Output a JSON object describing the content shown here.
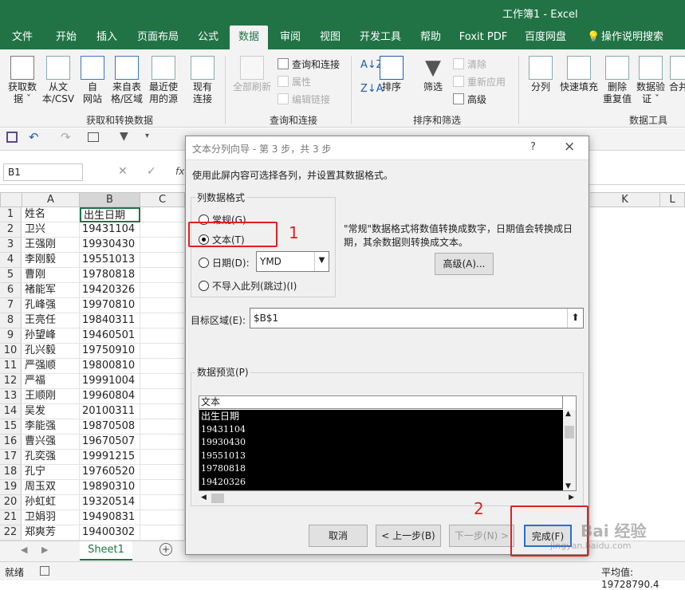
{
  "window": {
    "title": "工作簿1  -  Excel"
  },
  "tabs": [
    "文件",
    "开始",
    "插入",
    "页面布局",
    "公式",
    "数据",
    "审阅",
    "视图",
    "开发工具",
    "帮助",
    "Foxit PDF",
    "百度网盘",
    "操作说明搜索"
  ],
  "active_tab": "数据",
  "ribbon": {
    "get_data": [
      "获取数",
      "据 ˇ"
    ],
    "from_text": [
      "从文",
      "本/CSV"
    ],
    "from_web": [
      "自",
      "网站"
    ],
    "from_table": [
      "来自表",
      "格/区域"
    ],
    "recent_sources": [
      "最近使",
      "用的源"
    ],
    "existing_conn": [
      "现有",
      "连接"
    ],
    "group_get": "获取和转换数据",
    "refresh_all": [
      "全部刷新"
    ],
    "queries_conn": "查询和连接",
    "properties": "属性",
    "edit_links": "编辑链接",
    "group_queries": "查询和连接",
    "sort": "排序",
    "filter": "筛选",
    "clear": "清除",
    "reapply": "重新应用",
    "advanced": "高级",
    "group_sort": "排序和筛选",
    "split": "分列",
    "flash_fill": "快速填充",
    "remove_dup": [
      "删除",
      "重复值"
    ],
    "validation": [
      "数据验",
      "证 ˇ"
    ],
    "merge": [
      "合并"
    ],
    "group_tools": "数据工具"
  },
  "namebox": "B1",
  "fx": "fx",
  "columns": [
    "A",
    "B",
    "C",
    "K",
    "L"
  ],
  "rows": [
    [
      "1",
      "姓名",
      "出生日期"
    ],
    [
      "2",
      "卫兴",
      "19431104"
    ],
    [
      "3",
      "王强刚",
      "19930430"
    ],
    [
      "4",
      "李刚毅",
      "19551013"
    ],
    [
      "5",
      "曹刚",
      "19780818"
    ],
    [
      "6",
      "褚能军",
      "19420326"
    ],
    [
      "7",
      "孔峰强",
      "19970810"
    ],
    [
      "8",
      "王亮任",
      "19840311"
    ],
    [
      "9",
      "孙望峰",
      "19460501"
    ],
    [
      "10",
      "孔兴毅",
      "19750910"
    ],
    [
      "11",
      "严强顺",
      "19800810"
    ],
    [
      "12",
      "严福",
      "19991004"
    ],
    [
      "13",
      "王顺刚",
      "19960804"
    ],
    [
      "14",
      "吴发",
      "20100311"
    ],
    [
      "15",
      "李能强",
      "19870508"
    ],
    [
      "16",
      "曹兴强",
      "19670507"
    ],
    [
      "17",
      "孔奕强",
      "19991215"
    ],
    [
      "18",
      "孔宁",
      "19760520"
    ],
    [
      "19",
      "周玉双",
      "19890310"
    ],
    [
      "20",
      "孙虹虹",
      "19320514"
    ],
    [
      "21",
      "卫娟羽",
      "19490831"
    ],
    [
      "22",
      "郑爽芳",
      "19400302"
    ]
  ],
  "sheet_tab": "Sheet1",
  "status": {
    "left": "就绪",
    "right": "平均值: 19728790.4"
  },
  "dialog": {
    "title": "文本分列向导 - 第 3 步，共 3 步",
    "help": "?",
    "close": "×",
    "instruction": "使用此屏内容可选择各列，并设置其数据格式。",
    "format_group": "列数据格式",
    "opt_general": "常规(G)",
    "opt_text": "文本(T)",
    "opt_date": "日期(D):",
    "date_value": "YMD",
    "opt_skip": "不导入此列(跳过)(I)",
    "desc": "\"常规\"数据格式将数值转换成数字，日期值会转换成日期，其余数据则转换成文本。",
    "advanced_btn": "高级(A)...",
    "dest_label": "目标区域(E):",
    "dest_value": "$B$1",
    "preview_label": "数据预览(P)",
    "preview_header": "文本",
    "preview_lines": [
      "出生日期",
      "19431104",
      "19930430",
      "19551013",
      "19780818",
      "19420326"
    ],
    "btn_cancel": "取消",
    "btn_back": "< 上一步(B)",
    "btn_next": "下一步(N) >",
    "btn_finish": "完成(F)"
  },
  "annotations": {
    "label1": "1",
    "label2": "2"
  },
  "watermark": {
    "line1": "Bai 经验",
    "line2": "jingyan.baidu.com"
  },
  "colors": {
    "excel_green": "#217346",
    "annotation_red": "#e02020"
  }
}
